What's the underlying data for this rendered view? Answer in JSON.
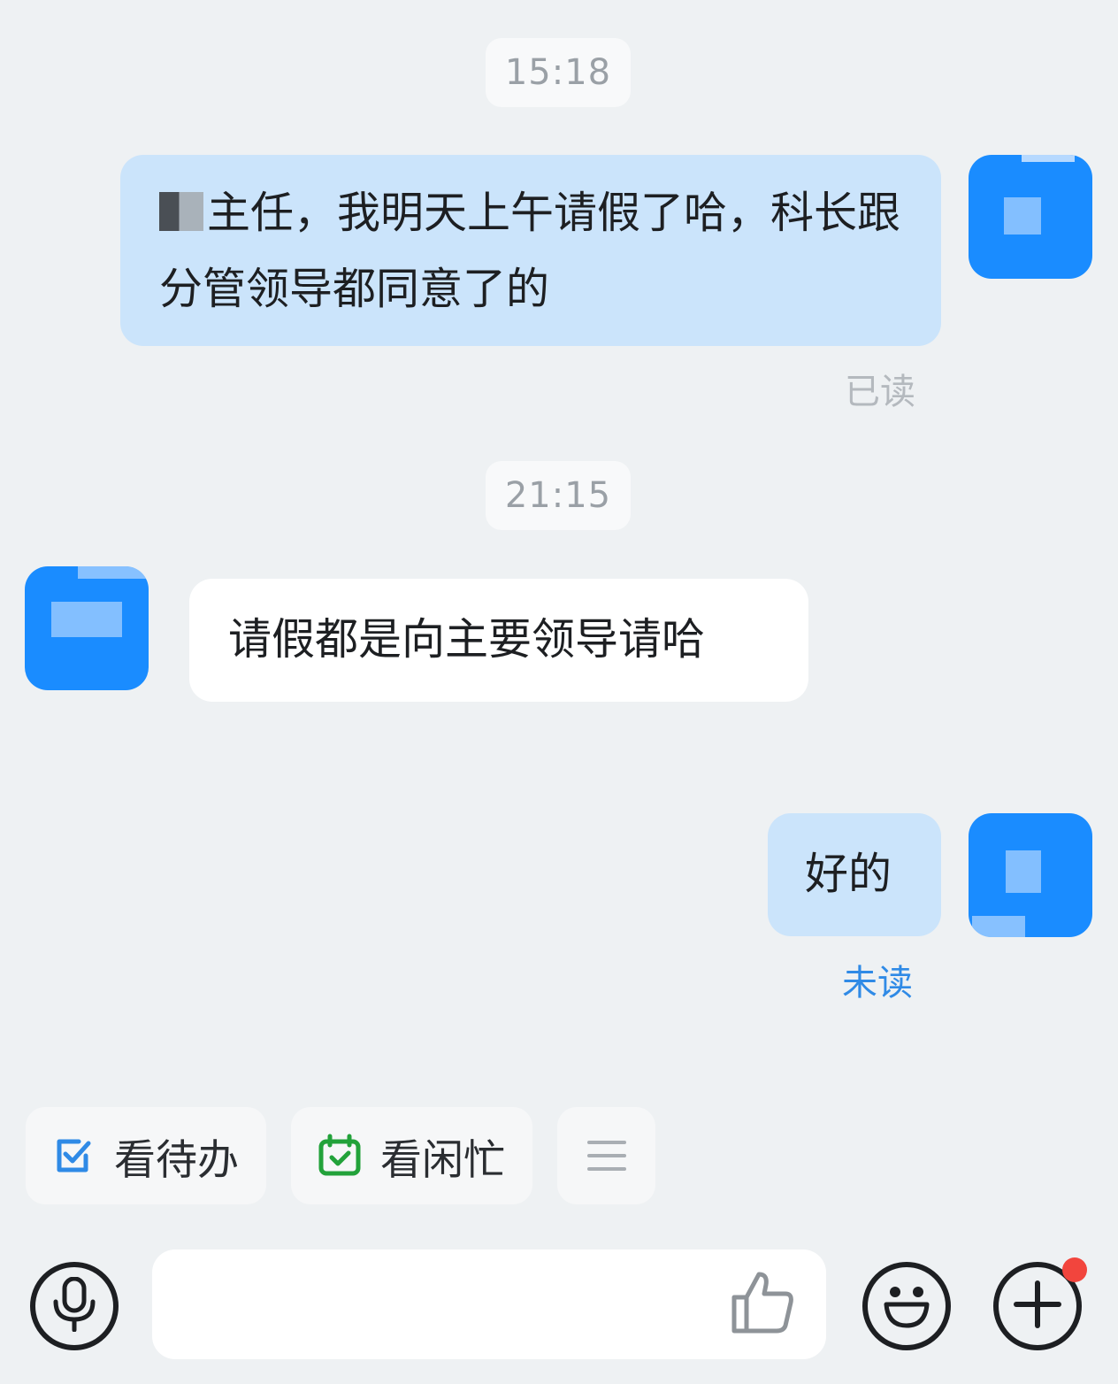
{
  "messages": [
    {
      "type": "time",
      "text": "15:18"
    },
    {
      "type": "message",
      "side": "mine",
      "text": "主任，我明天上午请假了哈，科长跟分管领导都同意了的",
      "status": "已读"
    },
    {
      "type": "time",
      "text": "21:15"
    },
    {
      "type": "message",
      "side": "theirs",
      "text": "请假都是向主要领导请哈"
    },
    {
      "type": "message",
      "side": "mine",
      "text": "好的",
      "status": "未读"
    }
  ],
  "quick_actions": [
    {
      "label": "看待办",
      "icon": "todo-check-icon",
      "color": "#2f8ae6"
    },
    {
      "label": "看闲忙",
      "icon": "calendar-check-icon",
      "color": "#22a23a"
    },
    {
      "label": "",
      "icon": "menu-icon",
      "color": "#a9aeb3"
    }
  ],
  "input": {
    "placeholder": "",
    "value": ""
  },
  "icons": [
    "microphone-icon",
    "thumbs-up-icon",
    "emoji-icon",
    "plus-icon"
  ],
  "colors": {
    "accent": "#1a8cff",
    "my_bubble": "#cbe4fb",
    "unread": "#2f8ae6",
    "notify": "#f2453d"
  }
}
